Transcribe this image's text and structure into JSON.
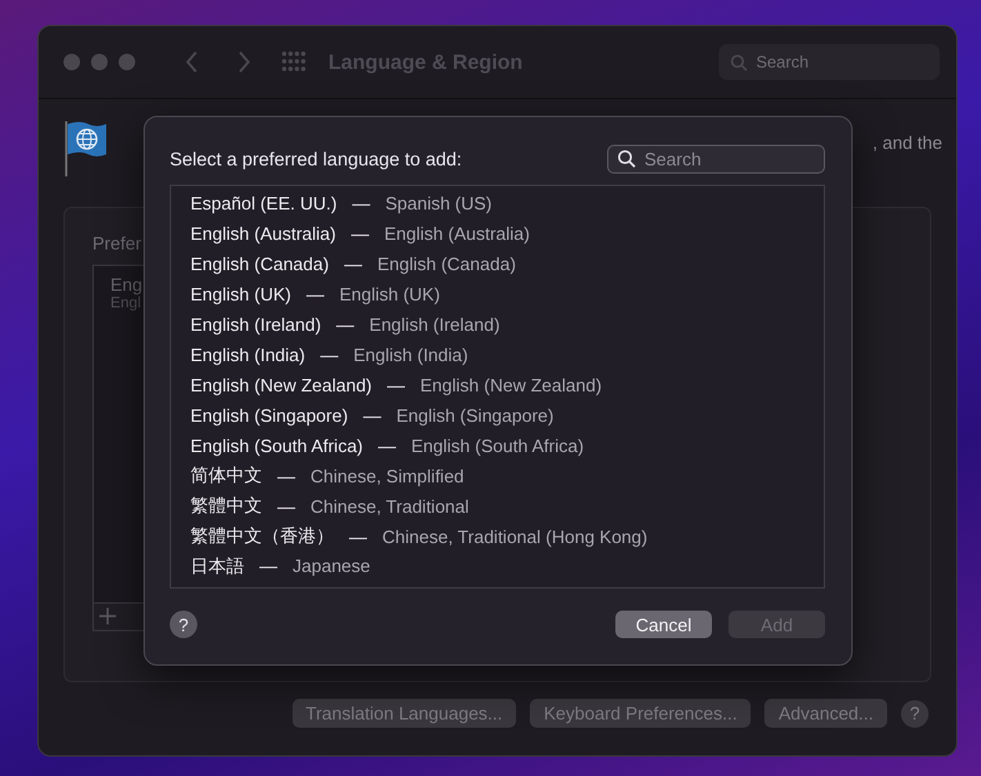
{
  "window": {
    "title": "Language & Region",
    "search": {
      "placeholder": "Search"
    }
  },
  "background": {
    "description_fragment": ", and the",
    "panel_label": "Prefer",
    "list_items": [
      {
        "primary": "Eng",
        "secondary": "Engl"
      }
    ],
    "bottom_buttons": [
      "Translation Languages...",
      "Keyboard Preferences...",
      "Advanced..."
    ]
  },
  "sheet": {
    "title": "Select a preferred language to add:",
    "search": {
      "placeholder": "Search"
    },
    "languages": [
      {
        "native": "Español (EE. UU.)",
        "translation": "Spanish (US)"
      },
      {
        "native": "English (Australia)",
        "translation": "English (Australia)"
      },
      {
        "native": "English (Canada)",
        "translation": "English (Canada)"
      },
      {
        "native": "English (UK)",
        "translation": "English (UK)"
      },
      {
        "native": "English (Ireland)",
        "translation": "English (Ireland)"
      },
      {
        "native": "English (India)",
        "translation": "English (India)"
      },
      {
        "native": "English (New Zealand)",
        "translation": "English (New Zealand)"
      },
      {
        "native": "English (Singapore)",
        "translation": "English (Singapore)"
      },
      {
        "native": "English (South Africa)",
        "translation": "English (South Africa)"
      },
      {
        "native": "简体中文",
        "translation": "Chinese, Simplified"
      },
      {
        "native": "繁體中文",
        "translation": "Chinese, Traditional"
      },
      {
        "native": "繁體中文（香港）",
        "translation": "Chinese, Traditional (Hong Kong)"
      },
      {
        "native": "日本語",
        "translation": "Japanese"
      }
    ],
    "separator": "—",
    "buttons": [
      {
        "label": "Cancel",
        "disabled": false
      },
      {
        "label": "Add",
        "disabled": true
      }
    ],
    "help": "?"
  },
  "help": "?"
}
